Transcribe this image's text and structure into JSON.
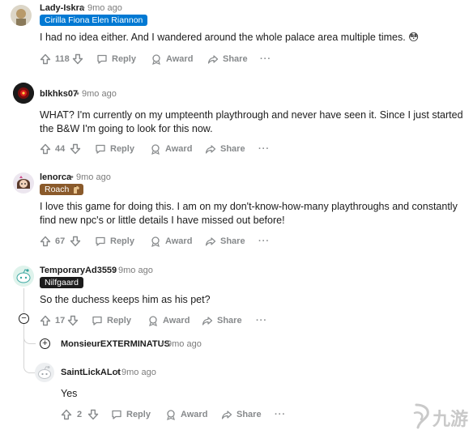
{
  "comments": [
    {
      "username": "Lady-Iskra",
      "time": "9mo ago",
      "flair": "Cirilla Fiona Elen Riannon",
      "body": "I had no idea either. And I wandered around the whole palace area multiple times. 😳",
      "votes": "118",
      "reply": "Reply",
      "award": "Award",
      "share": "Share",
      "more": "···"
    },
    {
      "username": "blkhks07",
      "time": "9mo ago",
      "body": "WHAT? I'm currently on my umpteenth playthrough and never have seen it. Since I just started the B&W I'm going to look for this now.",
      "votes": "44",
      "reply": "Reply",
      "award": "Award",
      "share": "Share",
      "more": "···"
    },
    {
      "username": "lenorca",
      "time": "9mo ago",
      "flair": "Roach",
      "body": "I love this game for doing this. I am on my don't-know-how-many playthroughs and constantly find new npc's or little details I have missed out before!",
      "votes": "67",
      "reply": "Reply",
      "award": "Award",
      "share": "Share",
      "more": "···"
    },
    {
      "username": "TemporaryAd3559",
      "time": "9mo ago",
      "flair": "Nilfgaard",
      "body": "So the duchess keeps him as his pet?",
      "votes": "17",
      "reply": "Reply",
      "award": "Award",
      "share": "Share",
      "more": "···"
    }
  ],
  "collapsed_reply": {
    "username": "MonsieurEXTERMINATUS",
    "time": "9mo ago"
  },
  "nested_reply": {
    "username": "SaintLickALot",
    "time": "9mo ago",
    "body": "Yes",
    "votes": "2",
    "reply": "Reply",
    "award": "Award",
    "share": "Share",
    "more": "···"
  },
  "separator": "•",
  "watermark": "九游",
  "colors": {
    "flair_blue": "#0079d3",
    "flair_brown": "#8a5a2b",
    "flair_dark": "#1c1c1c",
    "meta_gray": "#7c7c7c",
    "action_gray": "#878a8c"
  }
}
